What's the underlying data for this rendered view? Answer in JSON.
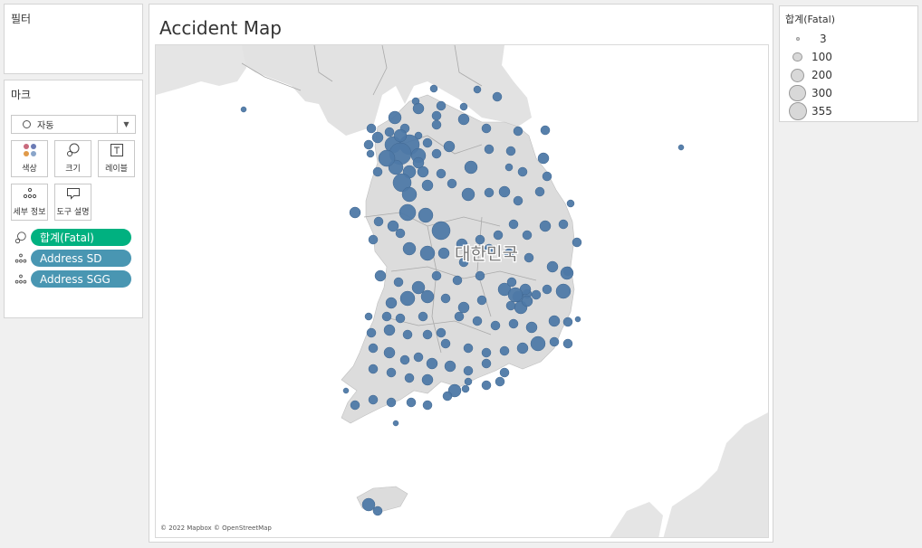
{
  "filters": {
    "title": "필터"
  },
  "marks": {
    "title": "마크",
    "mark_type": "자동",
    "tiles": [
      {
        "label": "색상",
        "icon": "color-dots-icon"
      },
      {
        "label": "크기",
        "icon": "size-icon"
      },
      {
        "label": "레이블",
        "icon": "label-icon"
      },
      {
        "label": "세부 정보",
        "icon": "detail-icon"
      },
      {
        "label": "도구 설명",
        "icon": "tooltip-icon"
      }
    ],
    "pills": [
      {
        "label": "합계(Fatal)",
        "icon": "size-icon",
        "color": "#00b180"
      },
      {
        "label": "Address SD",
        "icon": "detail-icon",
        "color": "#4996b2"
      },
      {
        "label": "Address SGG",
        "icon": "detail-icon",
        "color": "#4996b2"
      }
    ]
  },
  "sheet": {
    "title": "Accident Map",
    "map_label": "대한민국",
    "attribution": "© 2022 Mapbox © OpenStreetMap",
    "mark_color": "#4e79a7"
  },
  "legend": {
    "title": "합계(Fatal)",
    "items": [
      {
        "value": 3,
        "label": "3"
      },
      {
        "value": 100,
        "label": "100"
      },
      {
        "value": 200,
        "label": "200"
      },
      {
        "value": 300,
        "label": "300"
      },
      {
        "value": 355,
        "label": "355"
      }
    ]
  }
}
